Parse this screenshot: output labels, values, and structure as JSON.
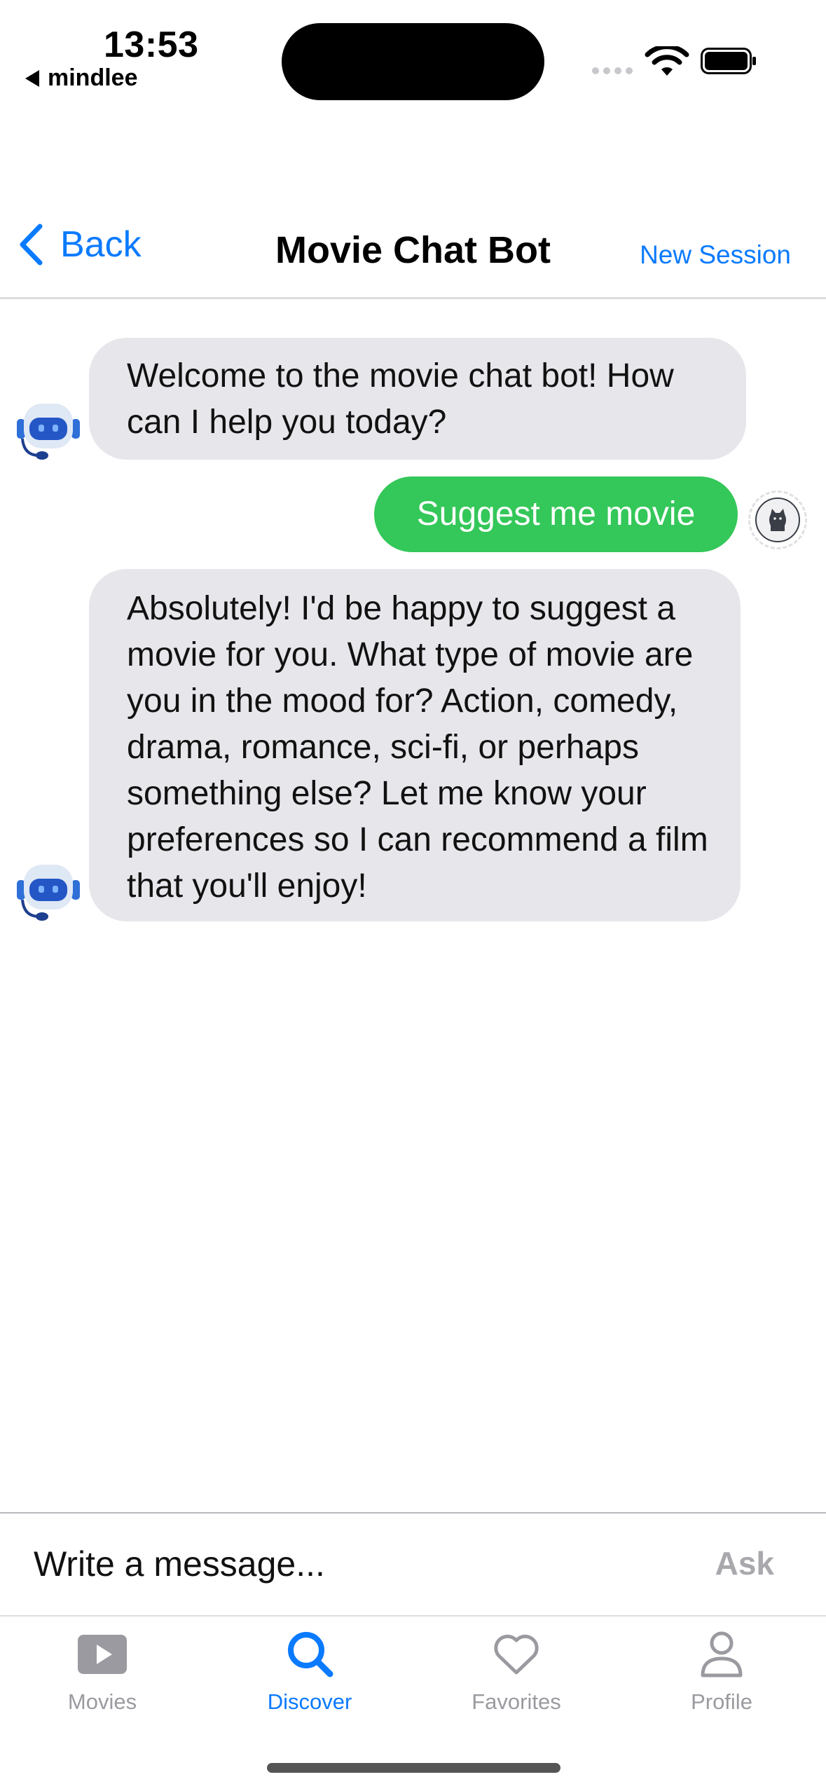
{
  "status_bar": {
    "time": "13:53",
    "back_app": "mindlee"
  },
  "nav": {
    "back_label": "Back",
    "title": "Movie Chat Bot",
    "new_session_label": "New Session"
  },
  "messages": [
    {
      "sender": "bot",
      "text": "Welcome to the movie chat bot! How can I help you today?"
    },
    {
      "sender": "user",
      "text": "Suggest me movie"
    },
    {
      "sender": "bot",
      "text": "Absolutely! I'd be happy to suggest a movie for you. What type of movie are you in the mood for? Action, comedy, drama, romance, sci-fi, or perhaps something else? Let me know your preferences so I can recommend a film that you'll enjoy!"
    }
  ],
  "composer": {
    "placeholder": "Write a message...",
    "ask_label": "Ask"
  },
  "tabs": [
    {
      "label": "Movies",
      "icon": "play-icon"
    },
    {
      "label": "Discover",
      "icon": "search-icon",
      "active": true
    },
    {
      "label": "Favorites",
      "icon": "heart-icon"
    },
    {
      "label": "Profile",
      "icon": "person-icon"
    }
  ],
  "colors": {
    "accent": "#0a7aff",
    "user_bubble": "#34c759",
    "bot_bubble": "#e6e6eb",
    "inactive_tab": "#9a9aa0"
  }
}
